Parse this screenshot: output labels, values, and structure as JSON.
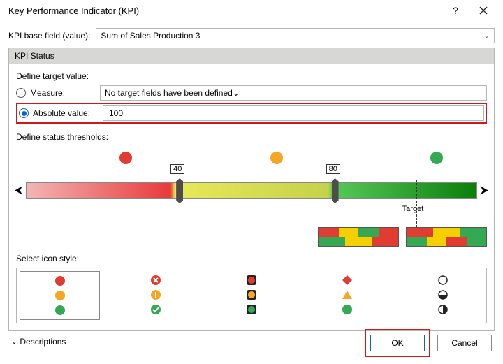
{
  "title": "Key Performance Indicator (KPI)",
  "base_field_label": "KPI base field (value):",
  "base_field_value": "Sum of Sales Production 3",
  "status_group": "KPI Status",
  "define_target_label": "Define target value:",
  "measure": {
    "label": "Measure:",
    "value": "No target fields have been defined"
  },
  "absolute": {
    "label": "Absolute value:",
    "value": "100"
  },
  "thresholds_label": "Define status thresholds:",
  "threshold_low": "40",
  "threshold_high": "80",
  "target_label": "Target",
  "icon_style_label": "Select icon style:",
  "descriptions_label": "Descriptions",
  "ok": "OK",
  "cancel": "Cancel",
  "colors": {
    "red": "#e03c31",
    "amber": "#f5a623",
    "green": "#34a853"
  }
}
